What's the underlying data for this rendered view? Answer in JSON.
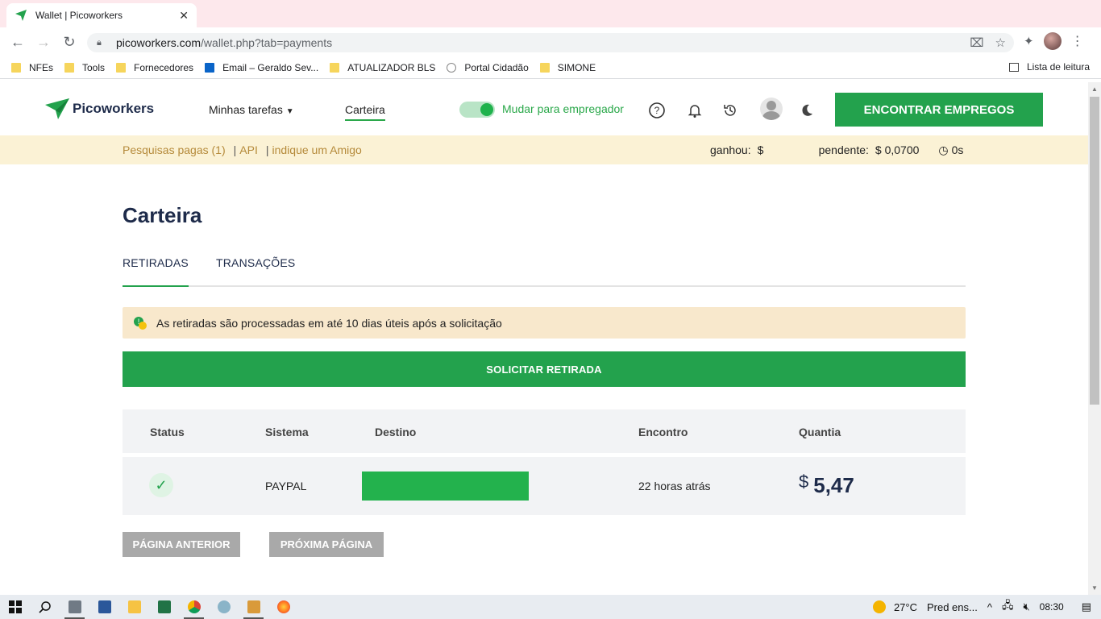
{
  "browser": {
    "tab_title": "Wallet | Picoworkers",
    "url_domain": "picoworkers.com",
    "url_path": "/wallet.php?tab=payments",
    "bookmarks": [
      "NFEs",
      "Tools",
      "Fornecedores",
      "Email – Geraldo Sev...",
      "ATUALIZADOR BLS",
      "Portal Cidadão",
      "SIMONE"
    ],
    "reading_list": "Lista de leitura"
  },
  "header": {
    "logo_text": "Picoworkers",
    "menu_tasks": "Minhas tarefas",
    "menu_wallet": "Carteira",
    "toggle_label": "Mudar para empregador",
    "cta": "ENCONTRAR EMPREGOS"
  },
  "subbar": {
    "link_surveys": "Pesquisas pagas (1)",
    "link_api": "API",
    "link_refer": "indique um Amigo",
    "earned_label": "ganhou:",
    "earned_value": "$",
    "pending_label": "pendente:",
    "pending_value": "$ 0,0700",
    "timer": "0s"
  },
  "main": {
    "title": "Carteira",
    "tabs": [
      "RETIRADAS",
      "TRANSAÇÕES"
    ],
    "notice": "As retiradas são processadas em até 10 dias úteis após a solicitação",
    "withdraw_button": "SOLICITAR RETIRADA",
    "table": {
      "headers": [
        "Status",
        "Sistema",
        "Destino",
        "Encontro",
        "Quantia"
      ],
      "rows": [
        {
          "system": "PAYPAL",
          "when": "22 horas atrás",
          "currency": "$",
          "amount": "5,47"
        }
      ]
    },
    "prev_page": "PÁGINA ANTERIOR",
    "next_page": "PRÓXIMA PÁGINA"
  },
  "taskbar": {
    "temperature": "27°C",
    "weather": "Pred ens...",
    "time": "08:30"
  },
  "colors": {
    "brand_green": "#23a24d",
    "subbar_bg": "#fbf2d5",
    "notice_bg": "#f8e8cc",
    "title_navy": "#1e2b4a"
  }
}
